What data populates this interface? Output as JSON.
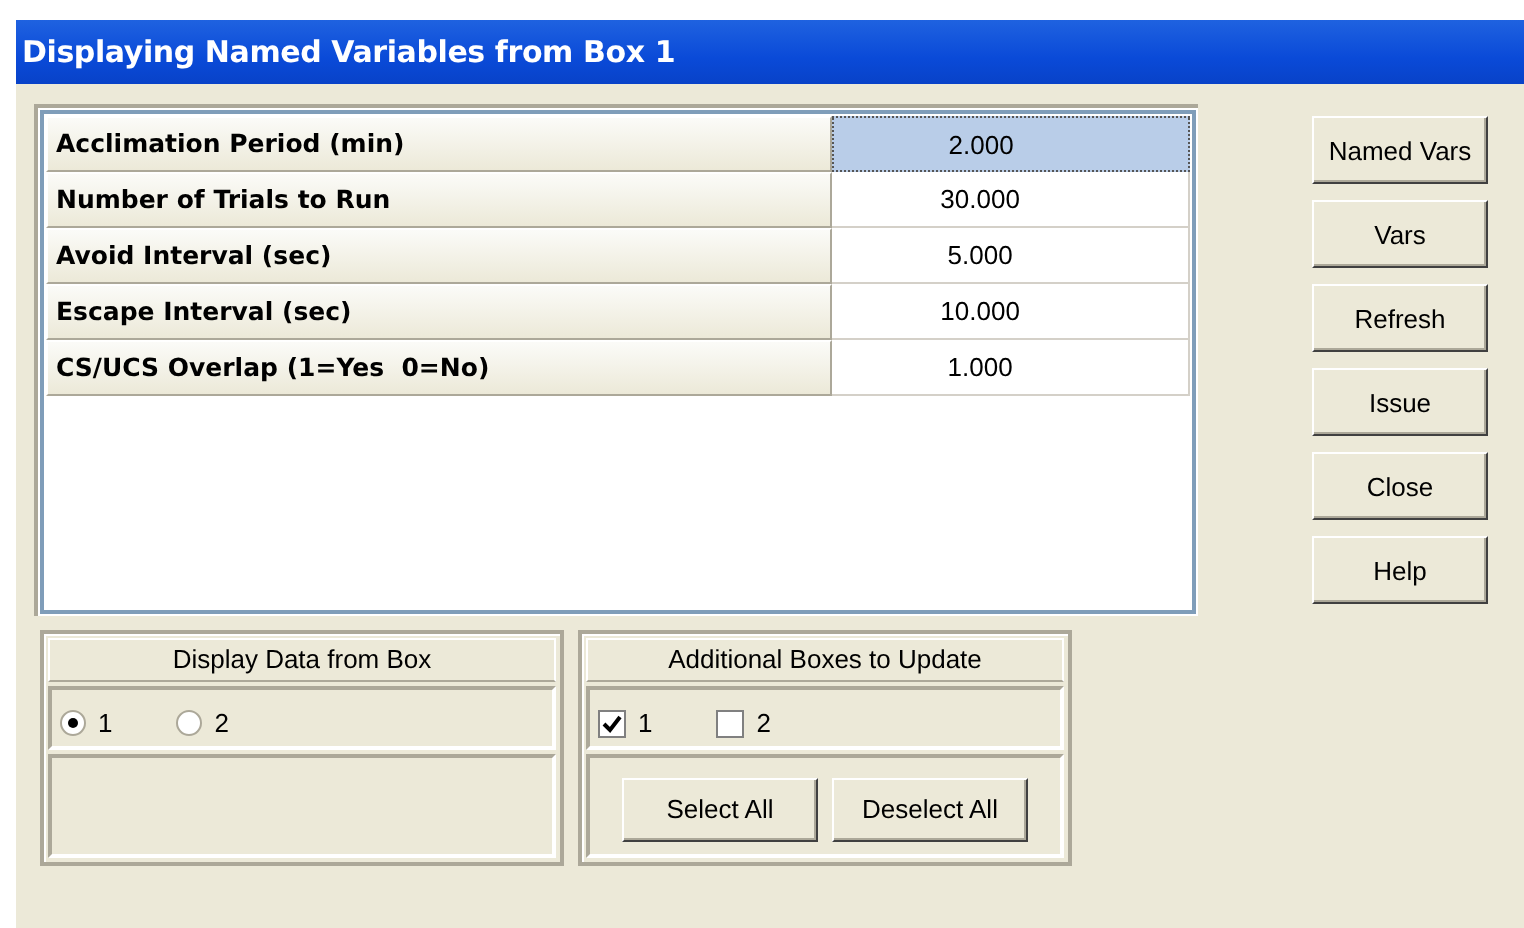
{
  "window": {
    "title": "Displaying Named Variables from Box 1"
  },
  "variables": [
    {
      "name": "Acclimation Period (min)",
      "value": "2.000",
      "selected": true
    },
    {
      "name": "Number of Trials to Run",
      "value": "30.000",
      "selected": false
    },
    {
      "name": "Avoid Interval (sec)",
      "value": "5.000",
      "selected": false
    },
    {
      "name": "Escape Interval (sec)",
      "value": "10.000",
      "selected": false
    },
    {
      "name": "CS/UCS Overlap (1=Yes  0=No)",
      "value": "1.000",
      "selected": false
    }
  ],
  "buttons": [
    "Named Vars",
    "Vars",
    "Refresh",
    "Issue",
    "Close",
    "Help"
  ],
  "display_box": {
    "title": "Display Data from Box",
    "options": [
      {
        "label": "1",
        "selected": true
      },
      {
        "label": "2",
        "selected": false
      }
    ]
  },
  "update_boxes": {
    "title": "Additional Boxes to Update",
    "options": [
      {
        "label": "1",
        "checked": true
      },
      {
        "label": "2",
        "checked": false
      }
    ],
    "buttons": [
      "Select All",
      "Deselect All"
    ]
  }
}
